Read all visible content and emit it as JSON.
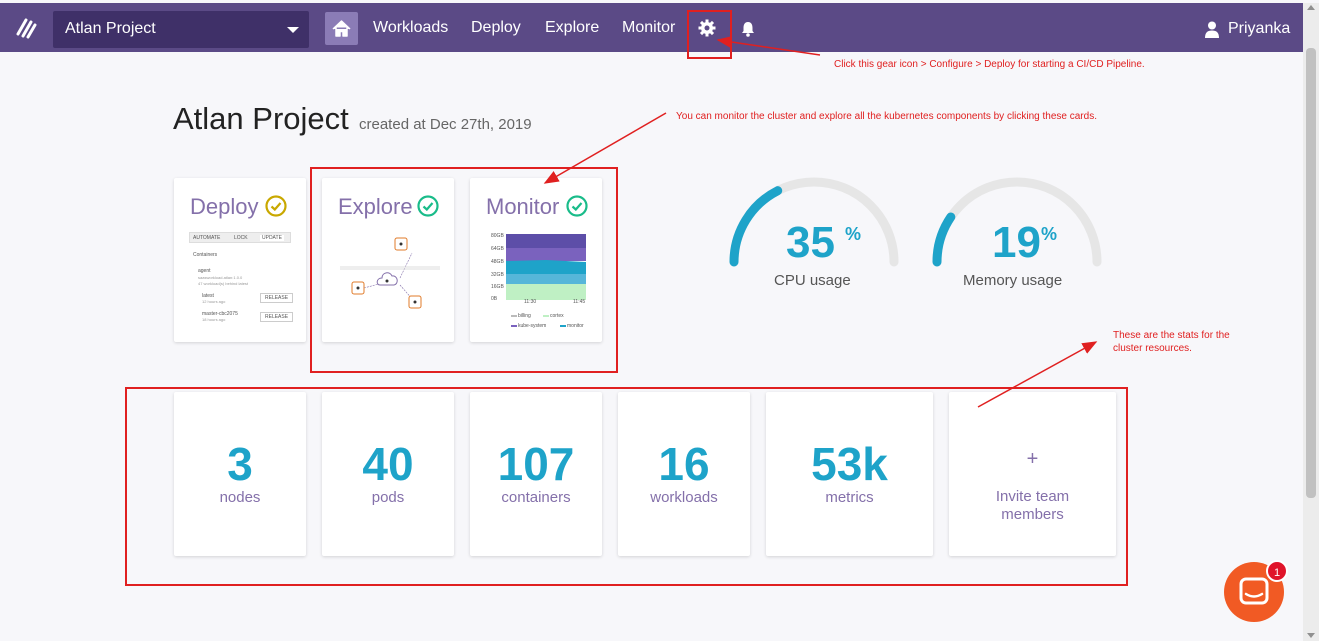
{
  "topbar": {
    "project_select": "Atlan Project",
    "nav": [
      "Workloads",
      "Deploy",
      "Explore",
      "Monitor"
    ],
    "user_name": "Priyanka"
  },
  "page": {
    "title": "Atlan Project",
    "subtitle": "created at Dec 27th, 2019"
  },
  "cards": {
    "deploy": {
      "title": "Deploy",
      "toolbar": [
        "AUTOMATE",
        "LOCK",
        "UPDATE"
      ],
      "section": "Containers",
      "items": [
        {
          "name": "agent",
          "sub1": "saasworkload.atlan:1.0.0",
          "sub2": "47 workload(s) behind latest"
        },
        {
          "name": "latest",
          "sub1": "12 hours ago",
          "button": "RELEASE"
        },
        {
          "name": "master-cbc2075",
          "sub1": "18 hours ago",
          "button": "RELEASE"
        }
      ]
    },
    "explore": {
      "title": "Explore"
    },
    "monitor": {
      "title": "Monitor",
      "yticks": [
        "80GB",
        "64GB",
        "48GB",
        "32GB",
        "16GB",
        "0B"
      ],
      "xticks": [
        "11:30",
        "11:45"
      ],
      "legend": [
        "billing",
        "cortex",
        "kube-system",
        "monitor"
      ]
    }
  },
  "gauges": [
    {
      "value": "35",
      "unit": "%",
      "label": "CPU usage",
      "percent": 35
    },
    {
      "value": "19",
      "unit": "%",
      "label": "Memory usage",
      "percent": 19
    }
  ],
  "stats": [
    {
      "value": "3",
      "label": "nodes"
    },
    {
      "value": "40",
      "label": "pods"
    },
    {
      "value": "107",
      "label": "containers"
    },
    {
      "value": "16",
      "label": "workloads"
    },
    {
      "value": "53k",
      "label": "metrics"
    }
  ],
  "invite": {
    "plus": "+",
    "label_line1": "Invite team",
    "label_line2": "members"
  },
  "annotations": {
    "gear": "Click this gear icon > Configure > Deploy for starting a CI/CD Pipeline.",
    "cards": "You can monitor the cluster and explore all the kubernetes components by clicking these cards.",
    "stats_line1": "These are the stats for the",
    "stats_line2": "cluster resources."
  },
  "chat": {
    "badge": "1"
  },
  "colors": {
    "topbar": "#5b4a86",
    "accent": "#1ea3c9",
    "purple_text": "#8470aa",
    "annotation": "#e02020",
    "chat": "#f15a24"
  }
}
